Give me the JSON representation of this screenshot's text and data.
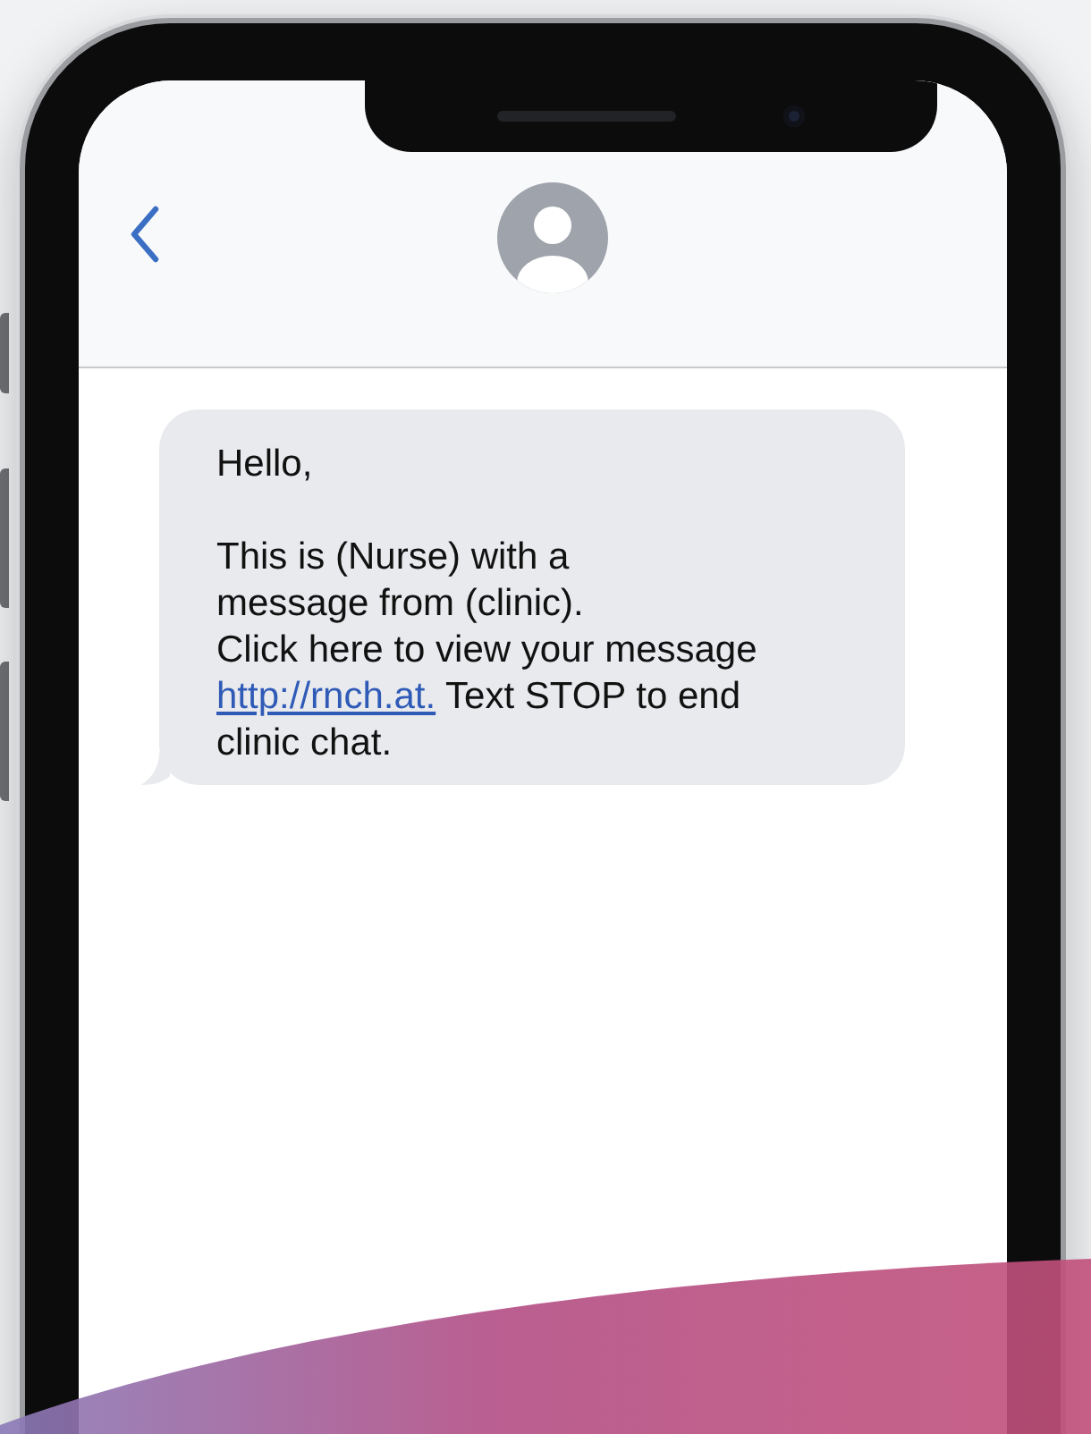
{
  "message": {
    "greeting": "Hello,",
    "body": "This is (Nurse) with a\nmessage from (clinic).\nClick here to view your message",
    "link": "http://rnch.at.",
    "after": "Text STOP to end\nclinic chat."
  }
}
